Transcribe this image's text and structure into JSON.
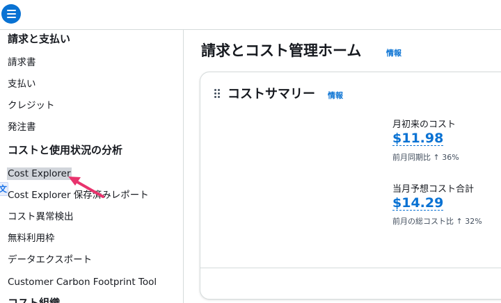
{
  "header": {
    "menu_icon": "hamburger-menu-icon"
  },
  "sidebar": {
    "section1_heading": "請求と支払い",
    "section1_items": [
      "請求書",
      "支払い",
      "クレジット",
      "発注書"
    ],
    "section2_heading": "コストと使用状況の分析",
    "section2_items": [
      "Cost Explorer",
      "Cost Explorer 保存済みレポート",
      "コスト異常検出",
      "無料利用枠",
      "データエクスポート",
      "Customer Carbon Footprint Tool"
    ],
    "section3_heading": "コスト組織",
    "active_item": "Cost Explorer",
    "translate_icon": "translate-icon"
  },
  "main": {
    "title": "請求とコスト管理ホーム",
    "info_label": "情報",
    "card": {
      "title": "コストサマリー",
      "info_label": "情報",
      "mtd_label": "月初来のコスト",
      "mtd_value": "$11.98",
      "mtd_compare": "前月同期比 ↑ 36%",
      "forecast_label": "当月予想コスト合計",
      "forecast_value": "$14.29",
      "forecast_compare": "前月の総コスト比 ↑ 32%"
    }
  },
  "colors": {
    "accent": "#0972d3",
    "annotation_arrow": "#e8336d"
  }
}
